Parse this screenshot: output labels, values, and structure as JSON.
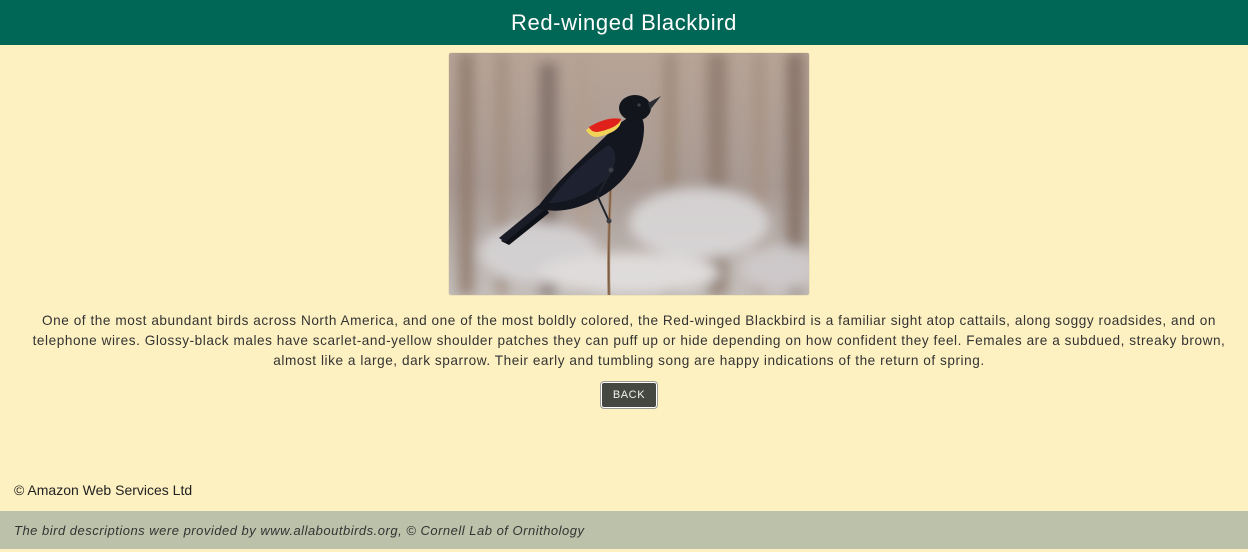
{
  "header": {
    "title": "Red-winged Blackbird"
  },
  "photo": {
    "subject": "red-winged blackbird perched on a reed stem"
  },
  "description": {
    "text": "One of the most abundant birds across North America, and one of the most boldly colored, the Red-winged Blackbird is a familiar sight atop cattails, along soggy roadsides, and on telephone wires. Glossy-black males have scarlet-and-yellow shoulder patches they can puff up or hide depending on how confident they feel. Females are a subdued, streaky brown, almost like a large, dark sparrow. Their early and tumbling song are happy indications of the return of spring."
  },
  "actions": {
    "back_label": "BACK"
  },
  "copyright": {
    "text": "© Amazon Web Services Ltd"
  },
  "footer": {
    "attribution": "The bird descriptions were provided by www.allaboutbirds.org, © Cornell Lab of Ornithology"
  },
  "colors": {
    "header_bg": "#006656",
    "page_bg": "#fef1c1",
    "footer_bg": "#bcc2aa",
    "button_bg": "#454841"
  }
}
